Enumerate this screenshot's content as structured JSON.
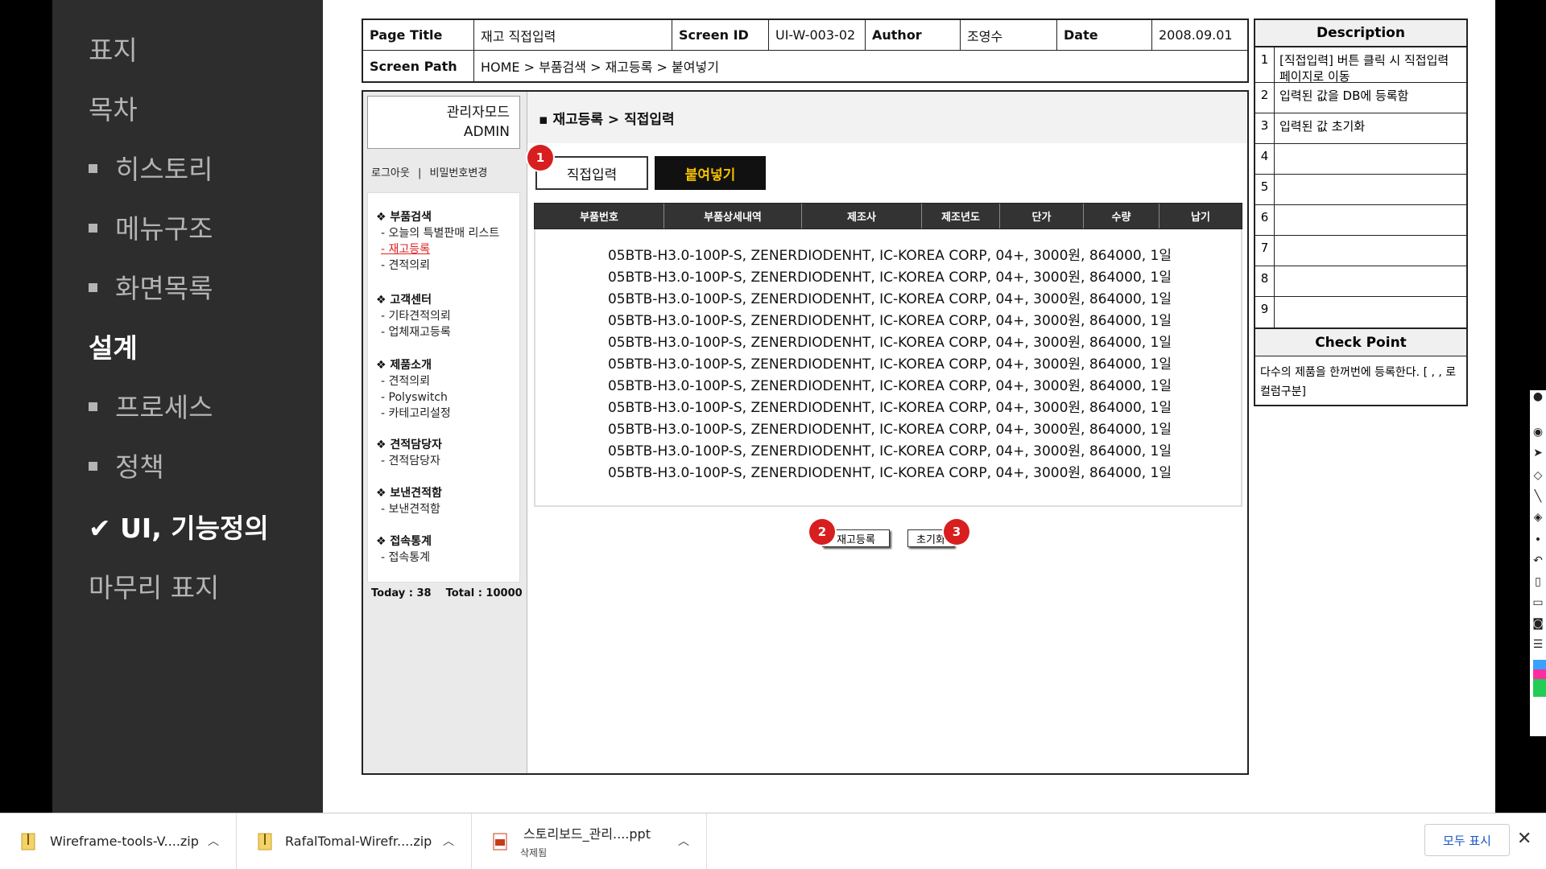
{
  "sidebar": {
    "items": [
      {
        "label": "표지",
        "bullet": false,
        "bold": false
      },
      {
        "label": "목차",
        "bullet": false,
        "bold": false
      },
      {
        "label": "히스토리",
        "bullet": true,
        "bold": false
      },
      {
        "label": "메뉴구조",
        "bullet": true,
        "bold": false
      },
      {
        "label": "화면목록",
        "bullet": true,
        "bold": false
      },
      {
        "label": "설계",
        "bullet": false,
        "bold": true
      },
      {
        "label": "프로세스",
        "bullet": true,
        "bold": false
      },
      {
        "label": "정책",
        "bullet": true,
        "bold": false
      },
      {
        "label": "✔ UI, 기능정의",
        "bullet": false,
        "bold": true
      },
      {
        "label": "마무리 표지",
        "bullet": false,
        "bold": false
      }
    ]
  },
  "header": {
    "page_title_label": "Page Title",
    "page_title": "재고 직접입력",
    "screen_id_label": "Screen ID",
    "screen_id": "UI-W-003-02",
    "author_label": "Author",
    "author": "조영수",
    "date_label": "Date",
    "date": "2008.09.01",
    "screen_path_label": "Screen Path",
    "screen_path": "HOME > 부품검색 > 재고등록 > 붙여넣기"
  },
  "description": {
    "title": "Description",
    "rows": [
      {
        "num": "1",
        "text": "[직접입력] 버튼 클릭 시 직접입력 페이지로 이동"
      },
      {
        "num": "2",
        "text": "입력된 값을 DB에 등록함"
      },
      {
        "num": "3",
        "text": "입력된 값 초기화"
      },
      {
        "num": "4",
        "text": ""
      },
      {
        "num": "5",
        "text": ""
      },
      {
        "num": "6",
        "text": ""
      },
      {
        "num": "7",
        "text": ""
      },
      {
        "num": "8",
        "text": ""
      },
      {
        "num": "9",
        "text": ""
      }
    ],
    "checkpoint_title": "Check Point",
    "checkpoint_text": "다수의 제품을 한꺼번에 등록한다. [ , , 로 컬럼구분]"
  },
  "wireframe": {
    "admin_line1": "관리자모드",
    "admin_line2": "ADMIN",
    "logout": "로그아웃",
    "separator": "|",
    "change_password": "비밀번호변경",
    "menu": [
      {
        "head": "❖ 부품검색",
        "subs": [
          "- 오늘의 특별판매 리스트",
          "- 재고등록",
          "- 견적의뢰"
        ]
      },
      {
        "head": "❖ 고객센터",
        "subs": [
          "- 기타견적의뢰",
          "- 업체재고등록"
        ]
      },
      {
        "head": "❖ 제품소개",
        "subs": [
          "- 견적의뢰",
          "- Polyswitch",
          "- 카테고리설정"
        ]
      },
      {
        "head": "❖ 견적담당자",
        "subs": [
          "- 견적담당자"
        ]
      },
      {
        "head": "❖ 보낸견적함",
        "subs": [
          "- 보낸견적함"
        ]
      },
      {
        "head": "❖ 접속통계",
        "subs": [
          "- 접속통계"
        ]
      }
    ],
    "counter": "Today : 38    Total : 10000",
    "breadcrumb": "▪ 재고등록 > 직접입력",
    "tab_direct": "직접입력",
    "tab_paste": "붙여넣기",
    "columns": [
      "부품번호",
      "부품상세내역",
      "제조사",
      "제조년도",
      "단가",
      "수량",
      "납기"
    ],
    "rows": [
      "05BTB-H3.0-100P-S, ZENERDIODENHT, IC-KOREA CORP, 04+, 3000원, 864000, 1일",
      "05BTB-H3.0-100P-S, ZENERDIODENHT, IC-KOREA CORP, 04+, 3000원, 864000, 1일",
      "05BTB-H3.0-100P-S, ZENERDIODENHT, IC-KOREA CORP, 04+, 3000원, 864000, 1일",
      "05BTB-H3.0-100P-S, ZENERDIODENHT, IC-KOREA CORP, 04+, 3000원, 864000, 1일",
      "05BTB-H3.0-100P-S, ZENERDIODENHT, IC-KOREA CORP, 04+, 3000원, 864000, 1일",
      "05BTB-H3.0-100P-S, ZENERDIODENHT, IC-KOREA CORP, 04+, 3000원, 864000, 1일",
      "05BTB-H3.0-100P-S, ZENERDIODENHT, IC-KOREA CORP, 04+, 3000원, 864000, 1일",
      "05BTB-H3.0-100P-S, ZENERDIODENHT, IC-KOREA CORP, 04+, 3000원, 864000, 1일",
      "05BTB-H3.0-100P-S, ZENERDIODENHT, IC-KOREA CORP, 04+, 3000원, 864000, 1일",
      "05BTB-H3.0-100P-S, ZENERDIODENHT, IC-KOREA CORP, 04+, 3000원, 864000, 1일",
      "05BTB-H3.0-100P-S, ZENERDIODENHT, IC-KOREA CORP, 04+, 3000원, 864000, 1일"
    ],
    "btn_register": "재고등록",
    "btn_reset": "초기화",
    "badges": [
      "1",
      "2",
      "3"
    ]
  },
  "downloads": {
    "items": [
      {
        "name": "Wireframe-tools-V....zip",
        "sub": "",
        "icon": "zip-file-icon"
      },
      {
        "name": "RafalTomal-Wirefr....zip",
        "sub": "",
        "icon": "zip-file-icon"
      },
      {
        "name": "스토리보드_관리....ppt",
        "sub": "삭제됨",
        "icon": "ppt-file-icon"
      }
    ],
    "show_all": "모두 표시"
  },
  "colors": {
    "sidebar_bg": "#2d2d2d",
    "badge": "#d81e1e",
    "paste_tab_text": "#f5c000",
    "link_active": "#d22"
  }
}
